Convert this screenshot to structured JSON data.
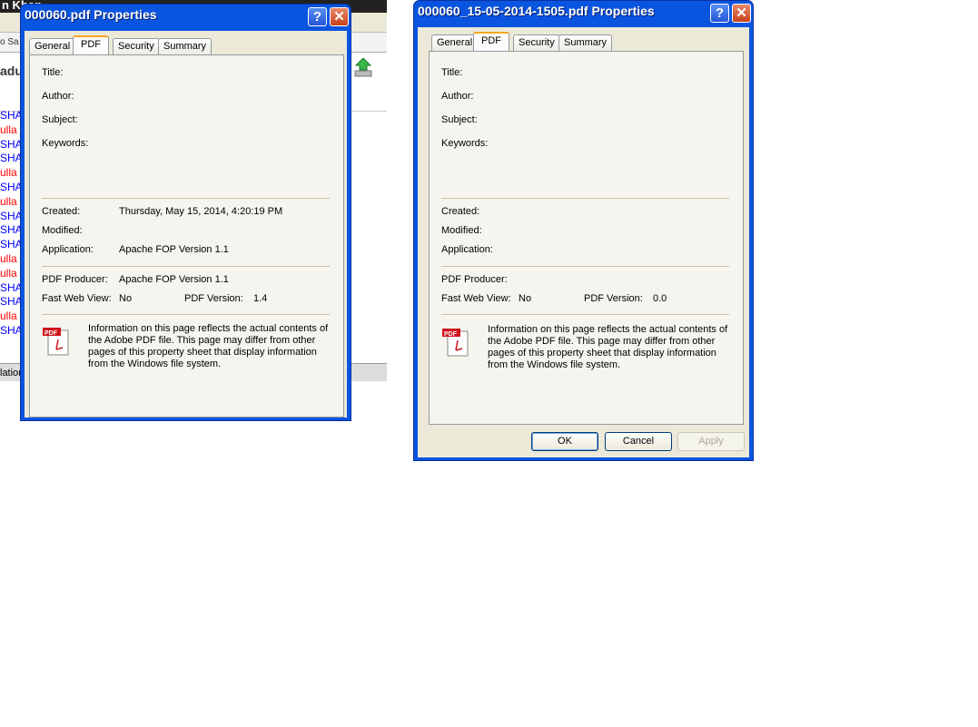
{
  "background_window": {
    "title": "n Khan",
    "toolbar_text": "o Sa",
    "heading": "adu",
    "footer_text": "lation",
    "list_items": [
      {
        "text": "SHA",
        "color": "#0000ff"
      },
      {
        "text": "ulla",
        "color": "#ff0000"
      },
      {
        "text": "SHA",
        "color": "#0000ff"
      },
      {
        "text": "SHA",
        "color": "#0000ff"
      },
      {
        "text": "ulla",
        "color": "#ff0000"
      },
      {
        "text": "SHA",
        "color": "#0000ff"
      },
      {
        "text": "ulla",
        "color": "#ff0000"
      },
      {
        "text": "SHA",
        "color": "#0000ff"
      },
      {
        "text": "SHA",
        "color": "#0000ff"
      },
      {
        "text": "SHA",
        "color": "#0000ff"
      },
      {
        "text": "ulla",
        "color": "#ff0000"
      },
      {
        "text": "ulla",
        "color": "#ff0000"
      },
      {
        "text": "SHA",
        "color": "#0000ff"
      },
      {
        "text": "SHA",
        "color": "#0000ff"
      },
      {
        "text": "ulla",
        "color": "#ff0000"
      },
      {
        "text": "SHA",
        "color": "#0000ff"
      }
    ]
  },
  "dialogs": [
    {
      "title": "000060.pdf Properties",
      "tabs": [
        "General",
        "PDF",
        "Security",
        "Summary"
      ],
      "active_tab": "PDF",
      "fields": {
        "title": {
          "label": "Title:",
          "value": ""
        },
        "author": {
          "label": "Author:",
          "value": ""
        },
        "subject": {
          "label": "Subject:",
          "value": ""
        },
        "keywords": {
          "label": "Keywords:",
          "value": ""
        },
        "created": {
          "label": "Created:",
          "value": "Thursday, May 15, 2014, 4:20:19 PM"
        },
        "modified": {
          "label": "Modified:",
          "value": ""
        },
        "application": {
          "label": "Application:",
          "value": "Apache FOP Version 1.1"
        },
        "producer": {
          "label": "PDF Producer:",
          "value": "Apache FOP Version 1.1"
        },
        "fast_web_view": {
          "label": "Fast Web View:",
          "value": "No"
        },
        "pdf_version": {
          "label": "PDF Version:",
          "value": "1.4"
        }
      },
      "info_text": "Information on this page reflects the actual contents of the Adobe PDF file. This page may differ from other pages of this property sheet that display information from the Windows file system.",
      "buttons": []
    },
    {
      "title": "000060_15-05-2014-1505.pdf Properties",
      "tabs": [
        "General",
        "PDF",
        "Security",
        "Summary"
      ],
      "active_tab": "PDF",
      "fields": {
        "title": {
          "label": "Title:",
          "value": ""
        },
        "author": {
          "label": "Author:",
          "value": ""
        },
        "subject": {
          "label": "Subject:",
          "value": ""
        },
        "keywords": {
          "label": "Keywords:",
          "value": ""
        },
        "created": {
          "label": "Created:",
          "value": ""
        },
        "modified": {
          "label": "Modified:",
          "value": ""
        },
        "application": {
          "label": "Application:",
          "value": ""
        },
        "producer": {
          "label": "PDF Producer:",
          "value": ""
        },
        "fast_web_view": {
          "label": "Fast Web View:",
          "value": "No"
        },
        "pdf_version": {
          "label": "PDF Version:",
          "value": "0.0"
        }
      },
      "info_text": "Information on this page reflects the actual contents of the Adobe PDF file. This page may differ from other pages of this property sheet that display information from the Windows file system.",
      "buttons": [
        {
          "label": "OK",
          "state": "default"
        },
        {
          "label": "Cancel",
          "state": "normal"
        },
        {
          "label": "Apply",
          "state": "disabled"
        }
      ]
    }
  ],
  "title_buttons": {
    "help": "?",
    "close": "✕"
  },
  "pdf_icon_text": "PDF"
}
